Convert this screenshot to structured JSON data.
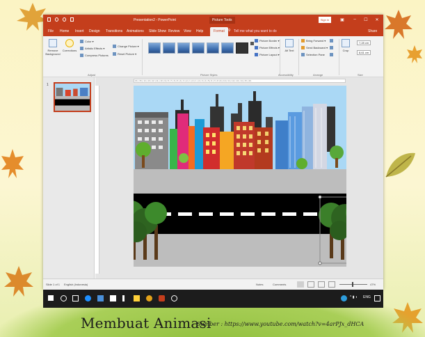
{
  "window": {
    "title": "Presentation2 - PowerPoint",
    "picture_tools": "Picture Tools",
    "sign_in": "Sign in",
    "controls": {
      "ribbon_display": "▣",
      "minimize": "–",
      "maximize": "☐",
      "close": "✕"
    }
  },
  "tabs": [
    "File",
    "Home",
    "Insert",
    "Design",
    "Transitions",
    "Animations",
    "Slide Show",
    "Review",
    "View",
    "Help",
    "Format"
  ],
  "active_tab": "Format",
  "tell_me": "Tell me what you want to do",
  "share": "Share",
  "ribbon": {
    "adjust": {
      "remove_background": "Remove Background",
      "corrections": "Corrections",
      "color": "Color ▾",
      "artistic_effects": "Artistic Effects ▾",
      "compress": "Compress Pictures",
      "change": "Change Picture ▾",
      "reset": "Reset Picture ▾",
      "label": "Adjust"
    },
    "styles": {
      "border": "Picture Border ▾",
      "effects": "Picture Effects ▾",
      "layout": "Picture Layout ▾",
      "label": "Picture Styles"
    },
    "accessibility": {
      "alt_text": "Alt Text",
      "label": "Accessibility"
    },
    "arrange": {
      "bring_forward": "Bring Forward ▾",
      "send_backward": "Send Backward ▾",
      "selection_pane": "Selection Pane",
      "label": "Arrange"
    },
    "size": {
      "crop": "Crop",
      "height": "7,28 cm",
      "width": "8,61 cm",
      "label": "Size"
    }
  },
  "thumbnail": {
    "number": "1"
  },
  "ruler_text": "·16·|·15·|·14·|·13·|·12·|·11·|·10·|·9·|·8·|·7·|·6·|·5·|·4·|·3·|·2·|·1·|·0·|·1·|·2·|·3·|·4·|·5·|·6·|·7·|·8·|·9·|·10·|·11·|·12·|·13·|·14·|·15·|·16·",
  "status": {
    "slide": "Slide 1 of 1",
    "language": "English (Indonesia)",
    "notes": "Notes",
    "comments": "Comments",
    "zoom": "47%"
  },
  "taskbar": {
    "time": "ENG"
  },
  "caption": {
    "main": "Membuat Animasi",
    "source": "Sumber : https://www.youtube.com/watch?v=4arPJx_dHCA"
  }
}
